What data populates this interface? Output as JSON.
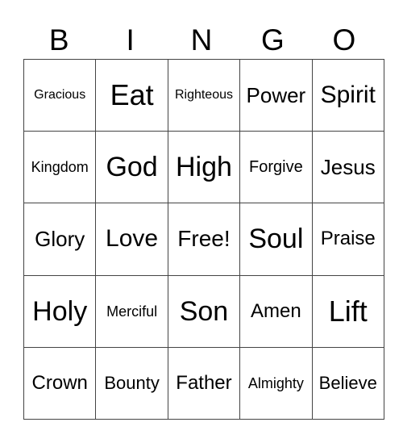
{
  "header": [
    "B",
    "I",
    "N",
    "G",
    "O"
  ],
  "rows": [
    [
      "Gracious",
      "Eat",
      "Righteous",
      "Power",
      "Spirit"
    ],
    [
      "Kingdom",
      "God",
      "High",
      "Forgive",
      "Jesus"
    ],
    [
      "Glory",
      "Love",
      "Free!",
      "Soul",
      "Praise"
    ],
    [
      "Holy",
      "Merciful",
      "Son",
      "Amen",
      "Lift"
    ],
    [
      "Crown",
      "Bounty",
      "Father",
      "Almighty",
      "Believe"
    ]
  ]
}
